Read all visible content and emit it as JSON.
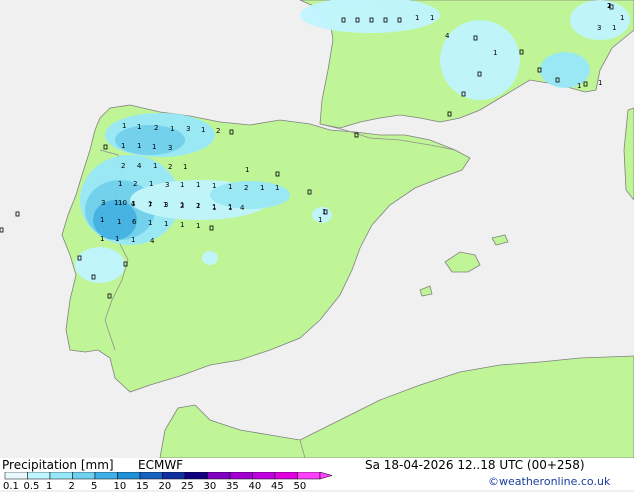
{
  "footer": {
    "title": "Precipitation [mm]",
    "model": "ECMWF",
    "valid_time": "Sa 18-04-2026 12..18 UTC (00+258)",
    "credit": "©weatheronline.co.uk"
  },
  "legend": {
    "ticks": [
      "0.1",
      "0.5",
      "1",
      "2",
      "5",
      "10",
      "15",
      "20",
      "25",
      "30",
      "35",
      "40",
      "45",
      "50"
    ],
    "colors": [
      "#e8faff",
      "#c0f4ff",
      "#98e8f8",
      "#70d0f0",
      "#40b0e8",
      "#2090d8",
      "#1860c0",
      "#1030a0",
      "#100080",
      "#8000c0",
      "#a000d0",
      "#c000e0",
      "#e000e0",
      "#ff40ff"
    ]
  },
  "map": {
    "colors": {
      "sea": "#f0f0f0",
      "land": "#bff596",
      "border": "#909090",
      "coast": "#707070"
    },
    "precip_labels": [
      "2",
      "3",
      "1",
      "1",
      "1",
      "1",
      "1",
      "4",
      "1",
      "1",
      "1",
      "1",
      "2",
      "1",
      "3",
      "1",
      "2",
      "1",
      "1",
      "1",
      "3",
      "2",
      "4",
      "1",
      "2",
      "1",
      "1",
      "1",
      "2",
      "1",
      "3",
      "1",
      "1",
      "1",
      "1",
      "2",
      "1",
      "1",
      "3",
      "1",
      "1",
      "1",
      "1",
      "1",
      "1",
      "1",
      "1",
      "10",
      "4",
      "7",
      "3",
      "2",
      "2",
      "1",
      "1",
      "1",
      "1",
      "6",
      "1",
      "1",
      "1",
      "1",
      "1",
      "1",
      "1",
      "4",
      "4",
      "1",
      "1",
      "1"
    ]
  }
}
